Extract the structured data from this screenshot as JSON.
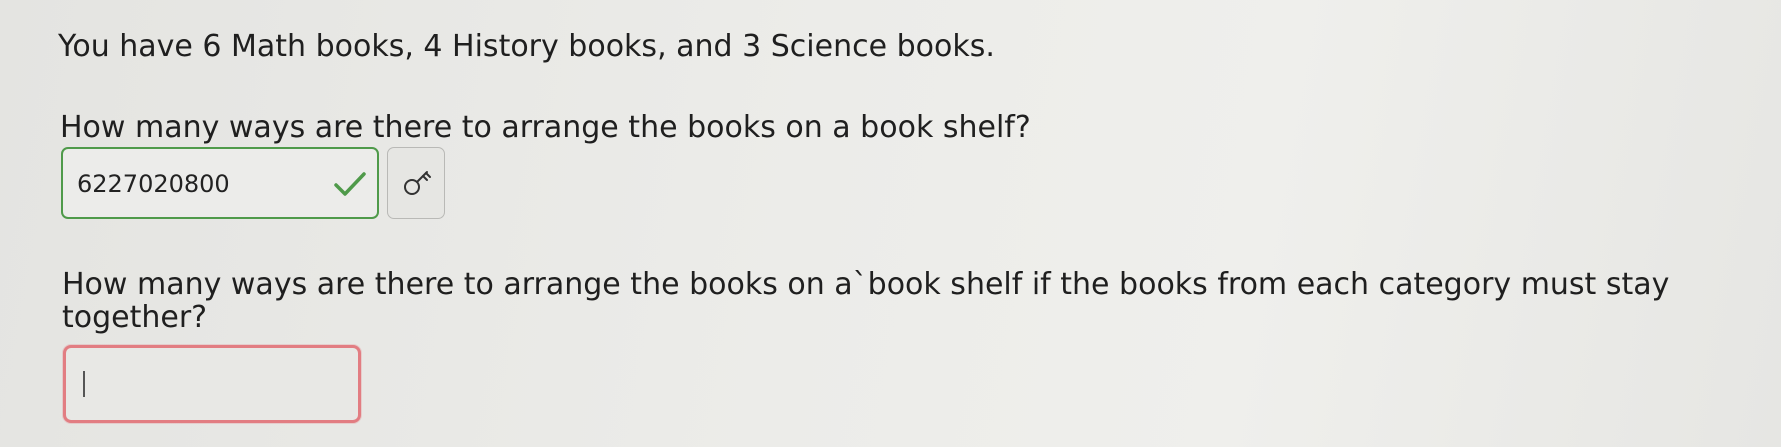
{
  "problem": {
    "intro": "You have 6 Math books, 4 History books, and 3 Science books."
  },
  "question1": {
    "text": "How many ways are there to arrange the books on a book shelf?",
    "answer_value": "6227020800",
    "status": "correct",
    "status_color": "#4f9a4a",
    "status_icon": "checkmark-icon",
    "tool_icon": "key-icon"
  },
  "question2": {
    "text": "How many ways are there to arrange the books on a`book shelf if the books from each category must stay together?",
    "answer_value": "",
    "status_color": "#e27d82"
  }
}
